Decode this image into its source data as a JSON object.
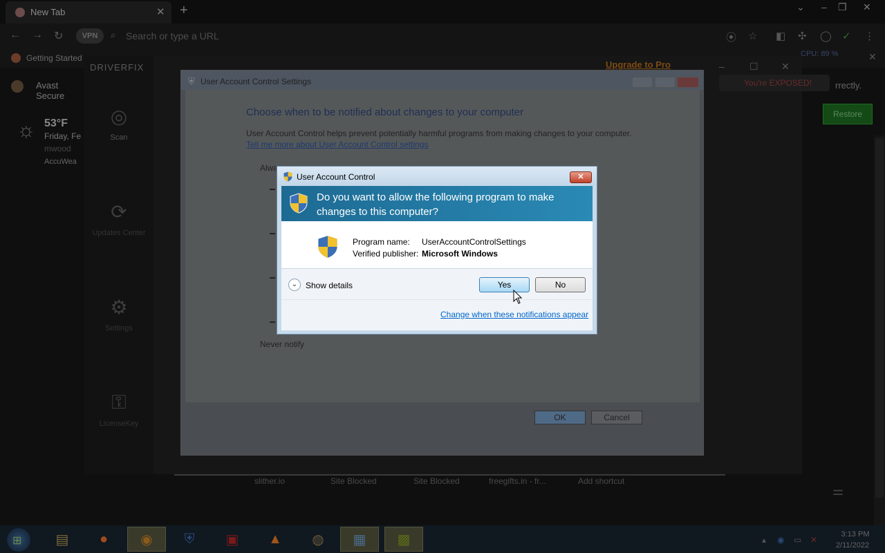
{
  "browser": {
    "tab_title": "New Tab",
    "vpn_label": "VPN",
    "omnibox_placeholder": "Search or type a URL",
    "bookmark_label": "Getting Started",
    "avast_label": "Avast Secure"
  },
  "weather": {
    "temp": "53°F",
    "day": "Friday, Fe",
    "location": "mwood",
    "source": "AccuWea"
  },
  "driverfix": {
    "logo": "DRIVERFIX",
    "nav": [
      "Scan",
      "Updates Center",
      "Settings",
      "LicenseKey"
    ],
    "upgrade_link": "Upgrade to Pro",
    "cpu": "CPU: 89 %",
    "exposed": "You're EXPOSED!",
    "correctly": "rrectly.",
    "restore": "Restore",
    "shortcuts": [
      "slither.io",
      "Site Blocked",
      "Site Blocked",
      "freegifts.in - fr...",
      "Add shortcut"
    ]
  },
  "uac_settings": {
    "title": "User Account Control Settings",
    "heading": "Choose when to be notified about changes to your computer",
    "description": "User Account Control helps prevent potentially harmful programs from making changes to your computer.",
    "link": "Tell me more about User Account Control settings",
    "always_label": "Alwa",
    "never_label": "Never notify",
    "ok_label": "OK",
    "cancel_label": "Cancel"
  },
  "uac_prompt": {
    "title": "User Account Control",
    "question": "Do you want to allow the following program to make changes to this computer?",
    "program_name_label": "Program name:",
    "program_name_value": "UserAccountControlSettings",
    "publisher_label": "Verified publisher:",
    "publisher_value": "Microsoft Windows",
    "show_details": "Show details",
    "yes": "Yes",
    "no": "No",
    "change_link": "Change when these notifications appear"
  },
  "taskbar": {
    "time": "3:13 PM",
    "date": "2/11/2022"
  },
  "colors": {
    "uac_banner": "#1d6a93",
    "link_blue": "#0066cc"
  }
}
